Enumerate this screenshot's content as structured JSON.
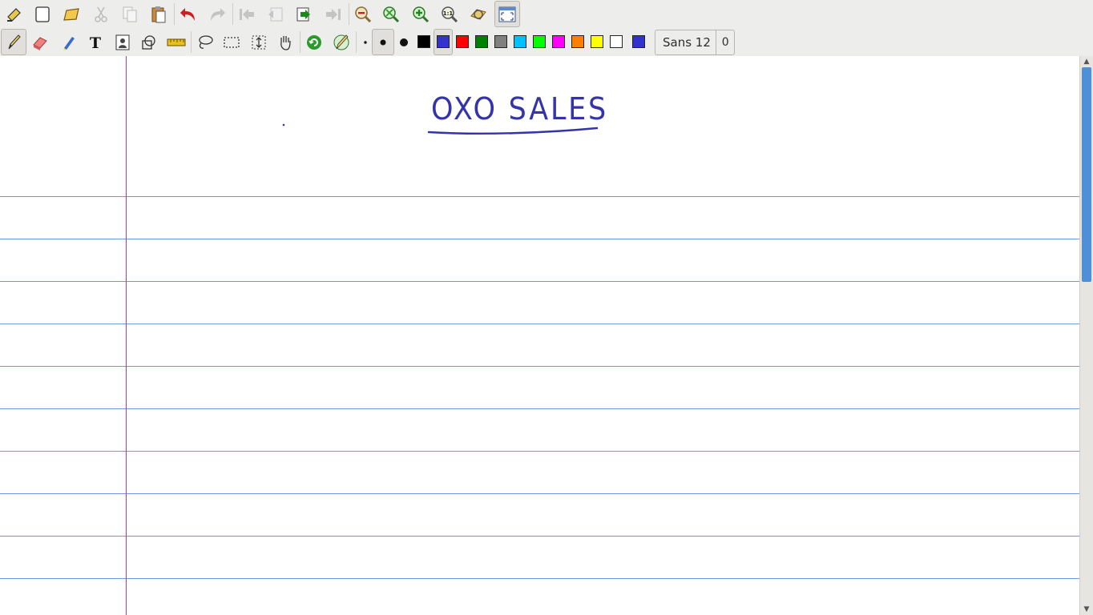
{
  "toolbar_top": {
    "buttons": [
      {
        "name": "save-icon",
        "enabled": true
      },
      {
        "name": "new-page-icon",
        "enabled": true
      },
      {
        "name": "open-icon",
        "enabled": true
      },
      {
        "name": "cut-icon",
        "enabled": false
      },
      {
        "name": "copy-icon",
        "enabled": false
      },
      {
        "name": "paste-icon",
        "enabled": true
      },
      {
        "name": "undo-icon",
        "enabled": true
      },
      {
        "name": "redo-icon",
        "enabled": false
      },
      {
        "name": "first-page-icon",
        "enabled": false
      },
      {
        "name": "previous-page-icon",
        "enabled": false
      },
      {
        "name": "next-page-icon",
        "enabled": true
      },
      {
        "name": "last-page-icon",
        "enabled": false
      },
      {
        "name": "zoom-out-icon",
        "enabled": true
      },
      {
        "name": "zoom-fit-icon",
        "enabled": true
      },
      {
        "name": "zoom-in-icon",
        "enabled": true
      },
      {
        "name": "zoom-100-icon",
        "enabled": true
      },
      {
        "name": "zoom-page-width-icon",
        "enabled": true
      },
      {
        "name": "fullscreen-icon",
        "enabled": true
      }
    ]
  },
  "toolbar_tools": {
    "active_tool": "pen",
    "active_thickness": "medium",
    "active_color": "#3333cc",
    "colors": [
      "#000000",
      "#3333cc",
      "#ff0000",
      "#008000",
      "#808080",
      "#00c0ff",
      "#00ff00",
      "#ff00ff",
      "#ff8000",
      "#ffff00",
      "#ffffff"
    ],
    "current_color": "#3333cc",
    "font_name": "Sans 12",
    "font_size_extra": "0"
  },
  "canvas": {
    "title_text": "OXO SALES",
    "paper": "lined",
    "line_color": "#7395e6",
    "margin_color": "#d8307d",
    "ink_color": "#3333aa"
  }
}
